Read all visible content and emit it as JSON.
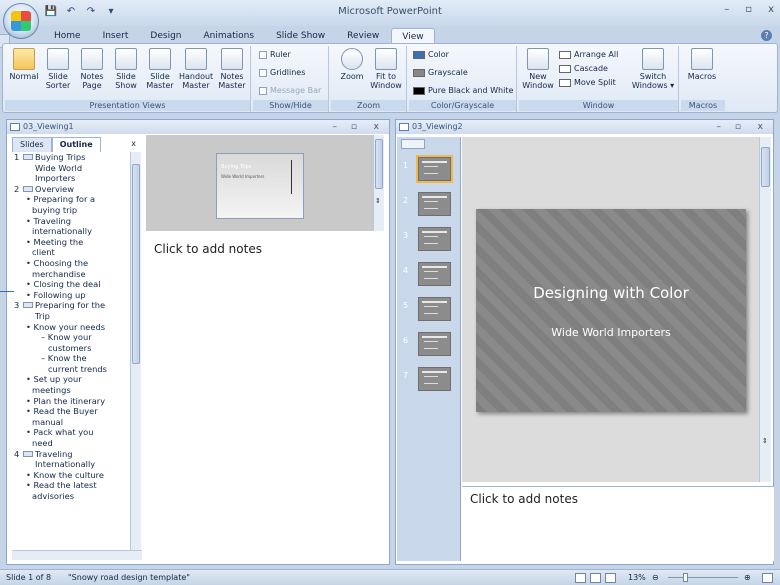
{
  "app": {
    "title": "Microsoft PowerPoint"
  },
  "qat": {
    "save": "💾",
    "undo": "↶",
    "redo": "↷",
    "more": "▾"
  },
  "window_controls": {
    "minimize": "–",
    "restore": "▫",
    "close": "x"
  },
  "tabs": [
    {
      "label": "Home"
    },
    {
      "label": "Insert"
    },
    {
      "label": "Design"
    },
    {
      "label": "Animations"
    },
    {
      "label": "Slide Show"
    },
    {
      "label": "Review"
    },
    {
      "label": "View",
      "active": true
    }
  ],
  "ribbon": {
    "presentation_views": {
      "label": "Presentation Views",
      "buttons": [
        "Normal",
        "Slide\nSorter",
        "Notes\nPage",
        "Slide\nShow",
        "Slide\nMaster",
        "Handout\nMaster",
        "Notes\nMaster"
      ]
    },
    "show_hide": {
      "label": "Show/Hide",
      "ruler": "Ruler",
      "gridlines": "Gridlines",
      "message_bar": "Message Bar"
    },
    "zoom": {
      "label": "Zoom",
      "zoom_btn": "Zoom",
      "fit_btn": "Fit to\nWindow"
    },
    "color_grayscale": {
      "label": "Color/Grayscale",
      "color": "Color",
      "grayscale": "Grayscale",
      "pure_bw": "Pure Black and White"
    },
    "window": {
      "label": "Window",
      "new_window": "New\nWindow",
      "arrange_all": "Arrange All",
      "cascade": "Cascade",
      "move_split": "Move Split",
      "switch_windows": "Switch\nWindows ▾"
    },
    "macros": {
      "label": "Macros",
      "macros_btn": "Macros"
    }
  },
  "left_window": {
    "title": "03_Viewing1",
    "tabs": {
      "slides": "Slides",
      "outline": "Outline",
      "close": "x"
    },
    "notes_placeholder": "Click to add notes",
    "thumb_title": "Buying Trips",
    "thumb_subtitle": "Wide World Importers",
    "outline": [
      {
        "num": "1",
        "title": "Buying Trips\nWide World\nImporters",
        "bullets": []
      },
      {
        "num": "2",
        "title": "Overview",
        "bullets": [
          {
            "level": 1,
            "text": "• Preparing for a\nbuying trip"
          },
          {
            "level": 1,
            "text": "• Traveling\ninternationally"
          },
          {
            "level": 1,
            "text": "• Meeting the\nclient"
          },
          {
            "level": 1,
            "text": "• Choosing the\nmerchandise"
          },
          {
            "level": 1,
            "text": "• Closing the deal"
          },
          {
            "level": 1,
            "text": "• Following up"
          }
        ]
      },
      {
        "num": "3",
        "title": "Preparing for the\nTrip",
        "bullets": [
          {
            "level": 1,
            "text": "• Know your needs"
          },
          {
            "level": 2,
            "text": "– Know your\ncustomers"
          },
          {
            "level": 2,
            "text": "– Know the\ncurrent trends"
          },
          {
            "level": 1,
            "text": "• Set up your\nmeetings"
          },
          {
            "level": 1,
            "text": "• Plan the itinerary"
          },
          {
            "level": 1,
            "text": "• Read the Buyer\nmanual"
          },
          {
            "level": 1,
            "text": "• Pack what you\nneed"
          }
        ]
      },
      {
        "num": "4",
        "title": "Traveling\nInternationally",
        "bullets": [
          {
            "level": 1,
            "text": "• Know the culture"
          },
          {
            "level": 1,
            "text": "• Read the latest\nadvisories"
          }
        ]
      }
    ]
  },
  "right_window": {
    "title": "03_Viewing2",
    "slide_title": "Designing with Color",
    "slide_subtitle": "Wide World Importers",
    "notes_placeholder": "Click to add notes",
    "thumb_numbers": [
      "1",
      "2",
      "3",
      "4",
      "5",
      "6",
      "7"
    ]
  },
  "status": {
    "slide": "Slide 1 of 8",
    "template": "\"Snowy road design template\"",
    "zoom": "13%"
  }
}
